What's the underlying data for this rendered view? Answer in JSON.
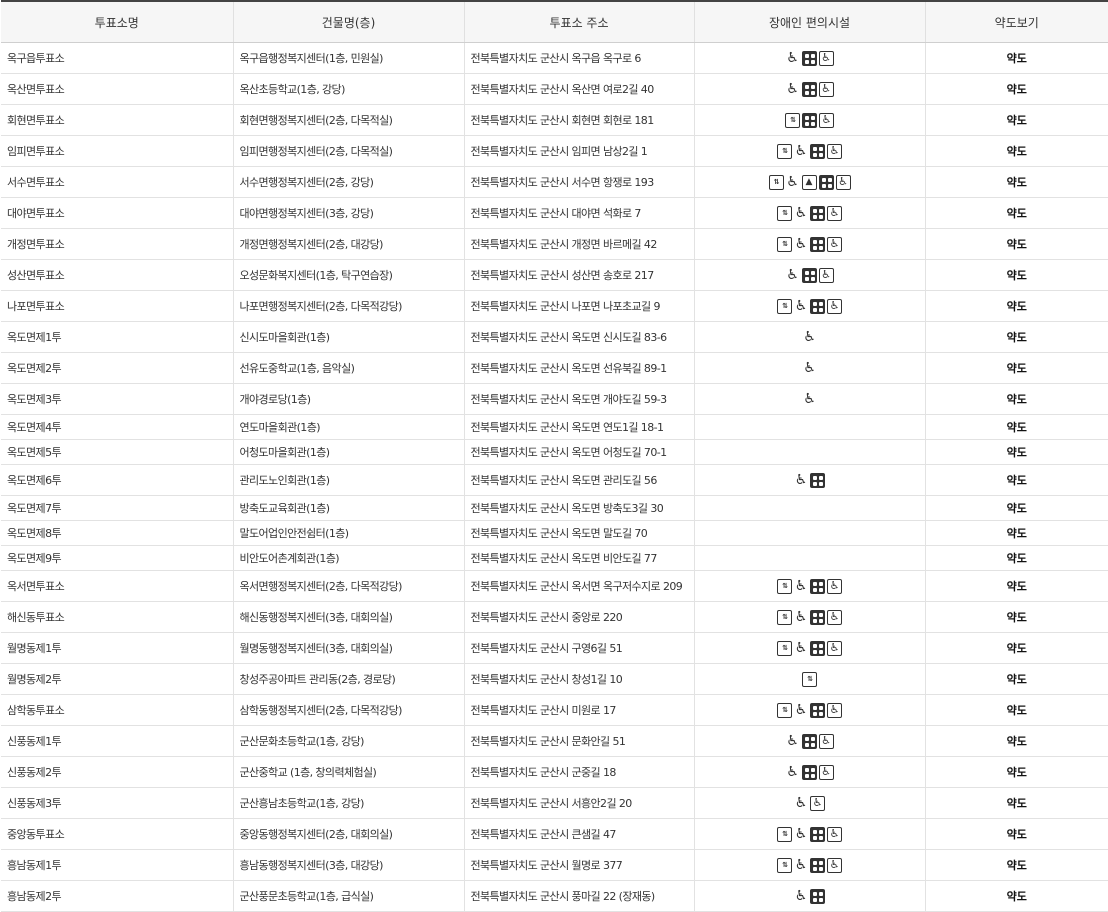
{
  "columns": [
    "투표소명",
    "건물명(층)",
    "투표소 주소",
    "장애인 편의시설",
    "약도보기"
  ],
  "map_label": "약도",
  "rows": [
    {
      "name": "옥구읍투표소",
      "building": "옥구읍행정복지센터(1층, 민원실)",
      "address": "전북특별자치도 군산시 옥구읍 옥구로 6",
      "facilities": [
        "wheelchair",
        "braille",
        "wheelchair-box"
      ]
    },
    {
      "name": "옥산면투표소",
      "building": "옥산초등학교(1층, 강당)",
      "address": "전북특별자치도 군산시 옥산면 여로2길 40",
      "facilities": [
        "wheelchair",
        "braille",
        "wheelchair-box"
      ]
    },
    {
      "name": "회현면투표소",
      "building": "회현면행정복지센터(2층, 다목적실)",
      "address": "전북특별자치도 군산시 회현면 회현로 181",
      "facilities": [
        "elevator",
        "braille",
        "wheelchair-box"
      ]
    },
    {
      "name": "임피면투표소",
      "building": "임피면행정복지센터(2층, 다목적실)",
      "address": "전북특별자치도 군산시 임피면 남상2길 1",
      "facilities": [
        "elevator",
        "wheelchair",
        "braille",
        "wheelchair-box"
      ]
    },
    {
      "name": "서수면투표소",
      "building": "서수면행정복지센터(2층, 강당)",
      "address": "전북특별자치도 군산시 서수면 항쟁로 193",
      "facilities": [
        "elevator",
        "wheelchair",
        "guide",
        "braille",
        "wheelchair-box"
      ]
    },
    {
      "name": "대야면투표소",
      "building": "대야면행정복지센터(3층, 강당)",
      "address": "전북특별자치도 군산시 대야면 석화로 7",
      "facilities": [
        "elevator",
        "wheelchair",
        "braille",
        "wheelchair-box"
      ]
    },
    {
      "name": "개정면투표소",
      "building": "개정면행정복지센터(2층, 대강당)",
      "address": "전북특별자치도 군산시 개정면 바르메길 42",
      "facilities": [
        "elevator",
        "wheelchair",
        "braille",
        "wheelchair-box"
      ]
    },
    {
      "name": "성산면투표소",
      "building": "오성문화복지센터(1층, 탁구연습장)",
      "address": "전북특별자치도 군산시 성산면 송호로 217",
      "facilities": [
        "wheelchair",
        "braille",
        "wheelchair-box"
      ]
    },
    {
      "name": "나포면투표소",
      "building": "나포면행정복지센터(2층, 다목적강당)",
      "address": "전북특별자치도 군산시 나포면 나포초교길 9",
      "facilities": [
        "elevator",
        "wheelchair",
        "braille",
        "wheelchair-box"
      ]
    },
    {
      "name": "옥도면제1투",
      "building": "신시도마을회관(1층)",
      "address": "전북특별자치도 군산시 옥도면 신시도길 83-6",
      "facilities": [
        "wheelchair"
      ]
    },
    {
      "name": "옥도면제2투",
      "building": "선유도중학교(1층, 음악실)",
      "address": "전북특별자치도 군산시 옥도면 선유북길 89-1",
      "facilities": [
        "wheelchair"
      ]
    },
    {
      "name": "옥도면제3투",
      "building": "개야경로당(1층)",
      "address": "전북특별자치도 군산시 옥도면 개야도길 59-3",
      "facilities": [
        "wheelchair"
      ]
    },
    {
      "name": "옥도면제4투",
      "building": "연도마을회관(1층)",
      "address": "전북특별자치도 군산시 옥도면 연도1길 18-1",
      "facilities": []
    },
    {
      "name": "옥도면제5투",
      "building": "어청도마을회관(1층)",
      "address": "전북특별자치도 군산시 옥도면 어청도길 70-1",
      "facilities": []
    },
    {
      "name": "옥도면제6투",
      "building": "관리도노인회관(1층)",
      "address": "전북특별자치도 군산시 옥도면 관리도길 56",
      "facilities": [
        "wheelchair",
        "braille"
      ]
    },
    {
      "name": "옥도면제7투",
      "building": "방축도교육회관(1층)",
      "address": "전북특별자치도 군산시 옥도면 방축도3길 30",
      "facilities": []
    },
    {
      "name": "옥도면제8투",
      "building": "말도어업인안전쉼터(1층)",
      "address": "전북특별자치도 군산시 옥도면 말도길 70",
      "facilities": []
    },
    {
      "name": "옥도면제9투",
      "building": "비안도어촌계회관(1층)",
      "address": "전북특별자치도 군산시 옥도면 비안도길 77",
      "facilities": []
    },
    {
      "name": "옥서면투표소",
      "building": "옥서면행정복지센터(2층, 다목적강당)",
      "address": "전북특별자치도 군산시 옥서면 옥구저수지로 209",
      "facilities": [
        "elevator",
        "wheelchair",
        "braille",
        "wheelchair-box"
      ]
    },
    {
      "name": "해신동투표소",
      "building": "해신동행정복지센터(3층, 대회의실)",
      "address": "전북특별자치도 군산시 중앙로 220",
      "facilities": [
        "elevator",
        "wheelchair",
        "braille",
        "wheelchair-box"
      ]
    },
    {
      "name": "월명동제1투",
      "building": "월명동행정복지센터(3층, 대회의실)",
      "address": "전북특별자치도 군산시 구영6길 51",
      "facilities": [
        "elevator",
        "wheelchair",
        "braille",
        "wheelchair-box"
      ]
    },
    {
      "name": "월명동제2투",
      "building": "창성주공아파트 관리동(2층, 경로당)",
      "address": "전북특별자치도 군산시 창성1길 10",
      "facilities": [
        "elevator"
      ]
    },
    {
      "name": "삼학동투표소",
      "building": "삼학동행정복지센터(2층, 다목적강당)",
      "address": "전북특별자치도 군산시 미원로 17",
      "facilities": [
        "elevator",
        "wheelchair",
        "braille",
        "wheelchair-box"
      ]
    },
    {
      "name": "신풍동제1투",
      "building": "군산문화초등학교(1층, 강당)",
      "address": "전북특별자치도 군산시 문화안길 51",
      "facilities": [
        "wheelchair",
        "braille",
        "wheelchair-box"
      ]
    },
    {
      "name": "신풍동제2투",
      "building": "군산중학교 (1층, 창의력체험실)",
      "address": "전북특별자치도 군산시 군중길 18",
      "facilities": [
        "wheelchair",
        "braille",
        "wheelchair-box"
      ]
    },
    {
      "name": "신풍동제3투",
      "building": "군산흥남초등학교(1층, 강당)",
      "address": "전북특별자치도 군산시 서흥안2길 20",
      "facilities": [
        "wheelchair",
        "wheelchair-box"
      ]
    },
    {
      "name": "중앙동투표소",
      "building": "중앙동행정복지센터(2층, 대회의실)",
      "address": "전북특별자치도 군산시 큰샘길 47",
      "facilities": [
        "elevator",
        "wheelchair",
        "braille",
        "wheelchair-box"
      ]
    },
    {
      "name": "흥남동제1투",
      "building": "흥남동행정복지센터(3층, 대강당)",
      "address": "전북특별자치도 군산시 월명로 377",
      "facilities": [
        "elevator",
        "wheelchair",
        "braille",
        "wheelchair-box"
      ]
    },
    {
      "name": "흥남동제2투",
      "building": "군산풍문초등학교(1층, 급식실)",
      "address": "전북특별자치도 군산시 풍마길 22 (장재동)",
      "facilities": [
        "wheelchair",
        "braille"
      ]
    }
  ]
}
